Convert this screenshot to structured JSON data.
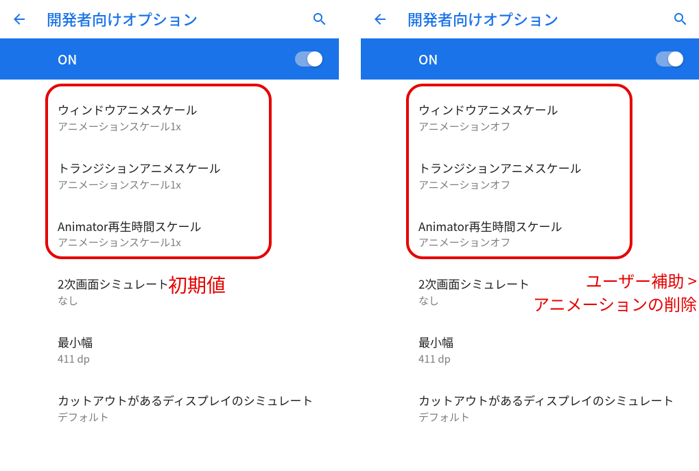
{
  "left": {
    "topbar": {
      "title": "開発者向けオプション"
    },
    "bluebar": {
      "label": "ON"
    },
    "items": [
      {
        "title": "ウィンドウアニメスケール",
        "sub": "アニメーションスケール1x"
      },
      {
        "title": "トランジションアニメスケール",
        "sub": "アニメーションスケール1x"
      },
      {
        "title": "Animator再生時間スケール",
        "sub": "アニメーションスケール1x"
      },
      {
        "title": "2次画面シミュレート",
        "sub": "なし"
      },
      {
        "title": "最小幅",
        "sub": "411 dp"
      },
      {
        "title": "カットアウトがあるディスプレイのシミュレート",
        "sub": "デフォルト"
      }
    ],
    "annotation": "初期値"
  },
  "right": {
    "topbar": {
      "title": "開発者向けオプション"
    },
    "bluebar": {
      "label": "ON"
    },
    "items": [
      {
        "title": "ウィンドウアニメスケール",
        "sub": "アニメーションオフ"
      },
      {
        "title": "トランジションアニメスケール",
        "sub": "アニメーションオフ"
      },
      {
        "title": "Animator再生時間スケール",
        "sub": "アニメーションオフ"
      },
      {
        "title": "2次画面シミュレート",
        "sub": "なし"
      },
      {
        "title": "最小幅",
        "sub": "411 dp"
      },
      {
        "title": "カットアウトがあるディスプレイのシミュレート",
        "sub": "デフォルト"
      }
    ],
    "annotation": "ユーザー補助 >\nアニメーションの削除"
  }
}
